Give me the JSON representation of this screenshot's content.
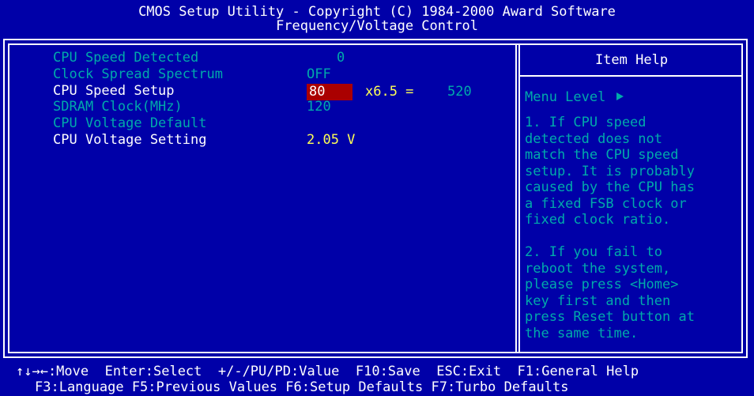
{
  "header": {
    "title": "CMOS Setup Utility - Copyright (C) 1984-2000 Award Software",
    "subtitle": "Frequency/Voltage Control"
  },
  "settings": [
    {
      "label": "CPU Speed Detected",
      "value": "0"
    },
    {
      "label": "Clock Spread Spectrum",
      "value": "OFF"
    },
    {
      "label": "CPU Speed Setup",
      "value": "80",
      "multiplier": "x6.5 =",
      "result": "520"
    },
    {
      "label": "SDRAM Clock(MHz)",
      "value": "120"
    },
    {
      "label": "CPU Voltage Default",
      "value": ""
    },
    {
      "label": "CPU Voltage Setting",
      "value": "2.05 V"
    }
  ],
  "help": {
    "title": "Item Help",
    "menu_level": "Menu Level",
    "text": "1. If CPU speed\ndetected does not\nmatch the CPU speed\nsetup. It is probably\ncaused by the CPU has\na fixed FSB clock or\nfixed clock ratio.\n\n2. If you fail to\nreboot the system,\nplease press <Home>\nkey first and then\npress Reset button at\nthe same time."
  },
  "footer": {
    "line1": "↑↓→←:Move  Enter:Select  +/-/PU/PD:Value  F10:Save  ESC:Exit  F1:General Help",
    "line2": "F3:Language F5:Previous Values F6:Setup Defaults F7:Turbo Defaults"
  },
  "colors": {
    "background": "#0000a8",
    "inactive_text": "#00aaaa",
    "active_text": "#ffffff",
    "value_text": "#ffff55",
    "selection": "#aa0000"
  }
}
